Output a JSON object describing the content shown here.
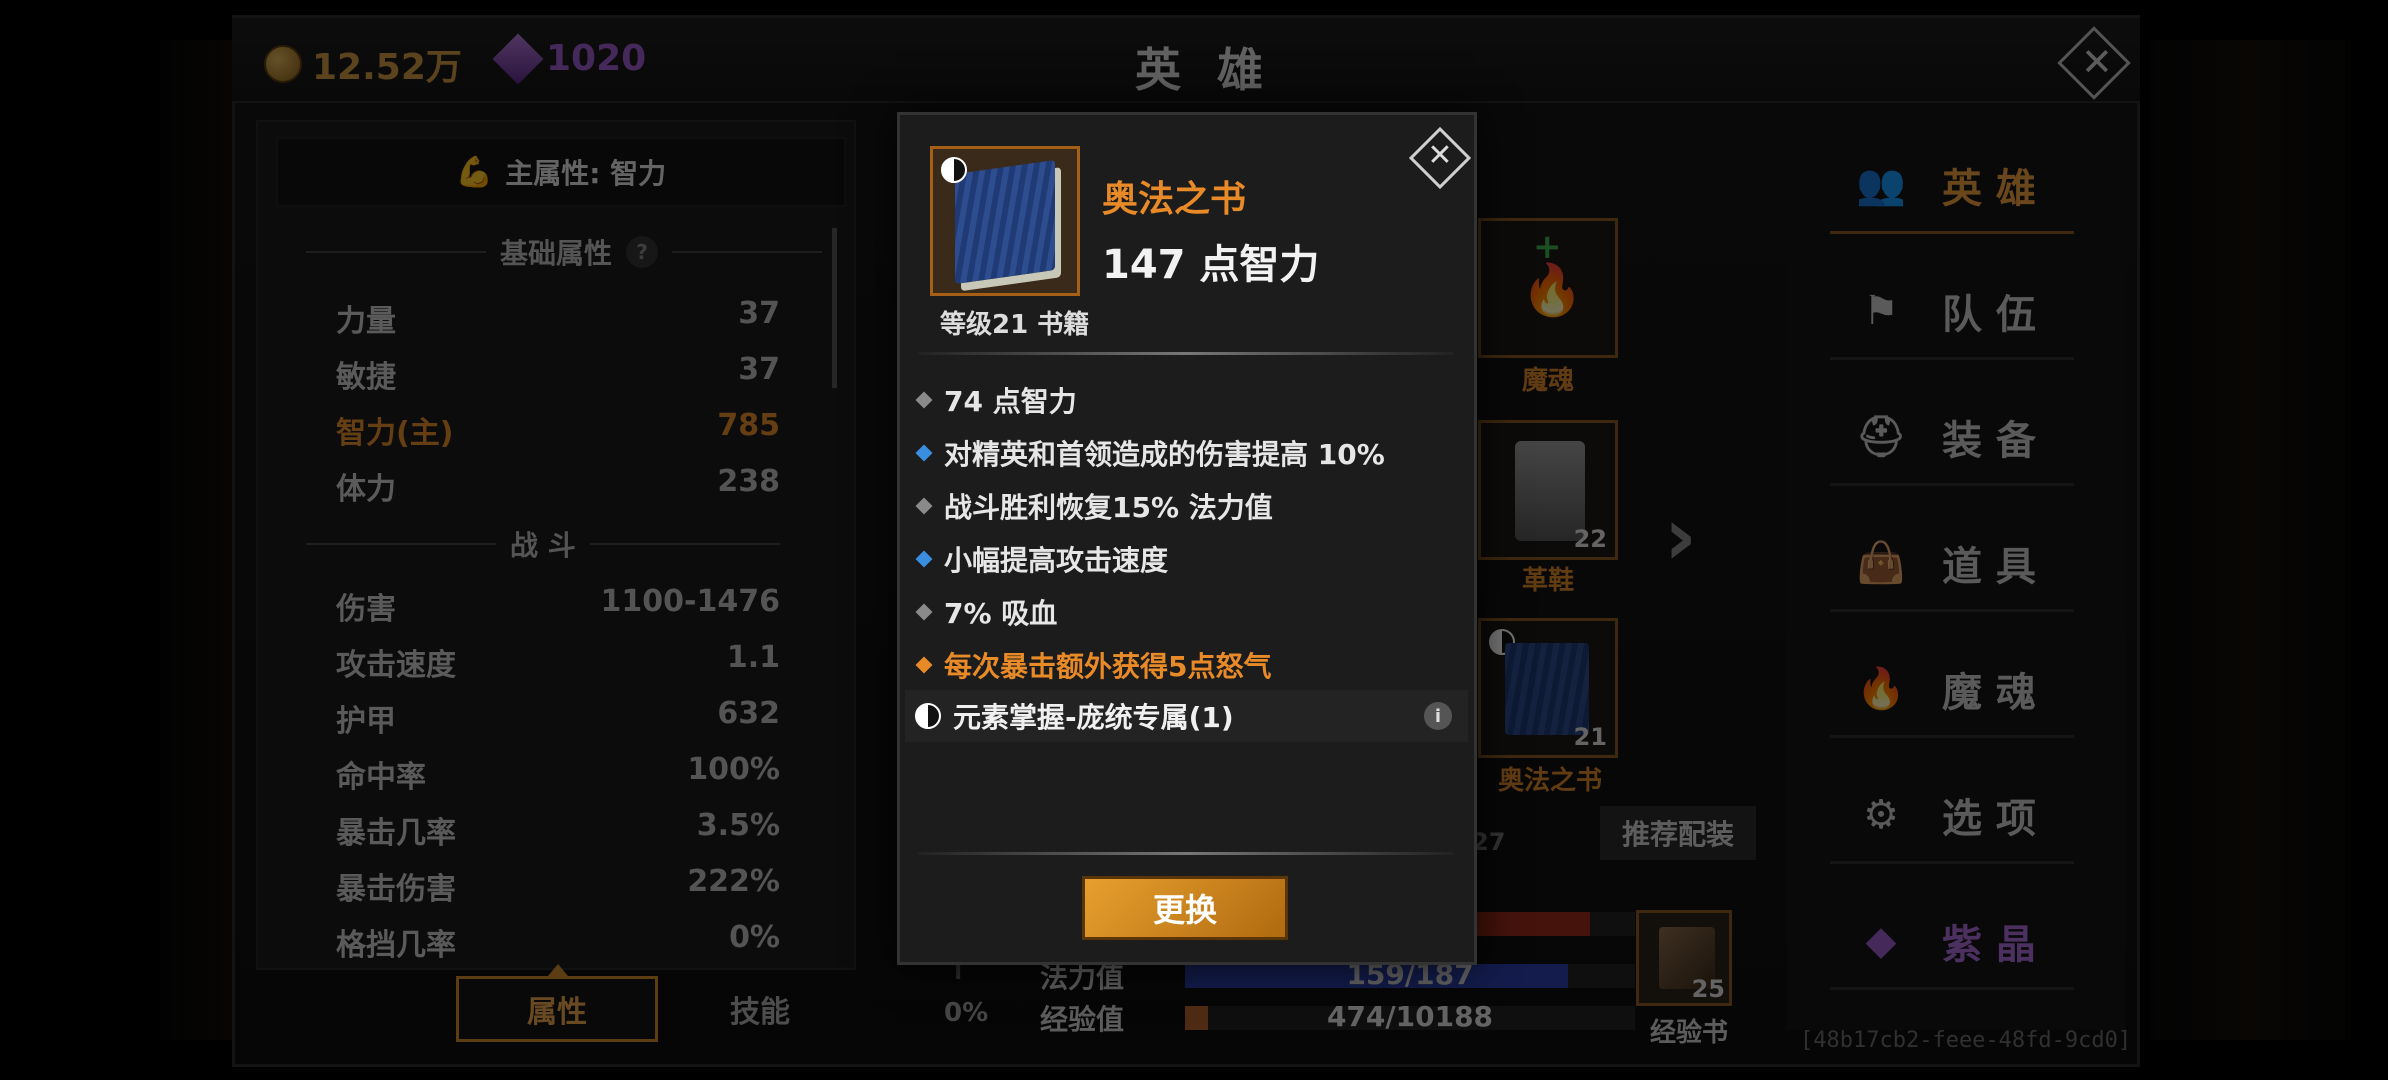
{
  "header": {
    "gold": "12.52万",
    "gems": "1020",
    "title": "英 雄"
  },
  "left_panel": {
    "main_attribute": "主属性: 智力",
    "basic_section": "基础属性",
    "basic_stats": [
      {
        "label": "力量",
        "value": "37"
      },
      {
        "label": "敏捷",
        "value": "37"
      },
      {
        "label": "智力(主)",
        "value": "785"
      },
      {
        "label": "体力",
        "value": "238"
      }
    ],
    "combat_section": "战 斗",
    "combat_stats": [
      {
        "label": "伤害",
        "value": "1100-1476"
      },
      {
        "label": "攻击速度",
        "value": "1.1"
      },
      {
        "label": "护甲",
        "value": "632"
      },
      {
        "label": "命中率",
        "value": "100%"
      },
      {
        "label": "暴击几率",
        "value": "3.5%"
      },
      {
        "label": "暴击伤害",
        "value": "222%"
      },
      {
        "label": "格挡几率",
        "value": "0%"
      }
    ],
    "tabs": {
      "attributes": "属性",
      "skills": "技能"
    }
  },
  "equipment": {
    "slot_soul": {
      "label": "魔魂"
    },
    "slot_boots": {
      "label": "革鞋",
      "level": "22"
    },
    "slot_book": {
      "label": "奥法之书",
      "level": "21"
    },
    "partial_number": "27",
    "recommend_label": "推荐配装",
    "zero_percent": "0%",
    "bars": {
      "mana": {
        "label": "法力值",
        "text": "159/187",
        "fill": 0.85,
        "color": "#2a3ea8"
      },
      "exp": {
        "label": "经验值",
        "text": "474/10188",
        "fill": 0.05,
        "color": "#b0602a"
      },
      "hp": {
        "fill": 0.9,
        "color": "#9a2a1a"
      }
    },
    "exp_book": {
      "count": "25",
      "label": "经验书"
    },
    "hero_id": "[48b17cb2-feee-48fd-9cd0]"
  },
  "nav": [
    {
      "label": "英 雄",
      "icon": "users-icon"
    },
    {
      "label": "队 伍",
      "icon": "flag-icon"
    },
    {
      "label": "装 备",
      "icon": "helmet-icon"
    },
    {
      "label": "道 具",
      "icon": "bag-icon"
    },
    {
      "label": "魔 魂",
      "icon": "flame-icon"
    },
    {
      "label": "选 项",
      "icon": "gear-icon"
    },
    {
      "label": "紫 晶",
      "icon": "crystal-icon"
    }
  ],
  "modal": {
    "item_name": "奥法之书",
    "item_main": "147 点智力",
    "item_level": "等级21 书籍",
    "affixes": [
      {
        "text": "74 点智力",
        "color": "#8a8a8a"
      },
      {
        "text": "对精英和首领造成的伤害提高 10%",
        "color": "#3a8ee0"
      },
      {
        "text": "战斗胜利恢复15% 法力值",
        "color": "#8a8a8a"
      },
      {
        "text": "小幅提高攻击速度",
        "color": "#3a8ee0"
      },
      {
        "text": "7% 吸血",
        "color": "#8a8a8a"
      },
      {
        "text": "每次暴击额外获得5点怒气",
        "color": "#e88a28"
      }
    ],
    "set_bonus": "元素掌握-庞统专属(1)",
    "replace_button": "更换"
  },
  "colors": {
    "accent_orange": "#e88a28",
    "gold_text": "#c99640",
    "gem_purple": "#9a5cc8"
  }
}
